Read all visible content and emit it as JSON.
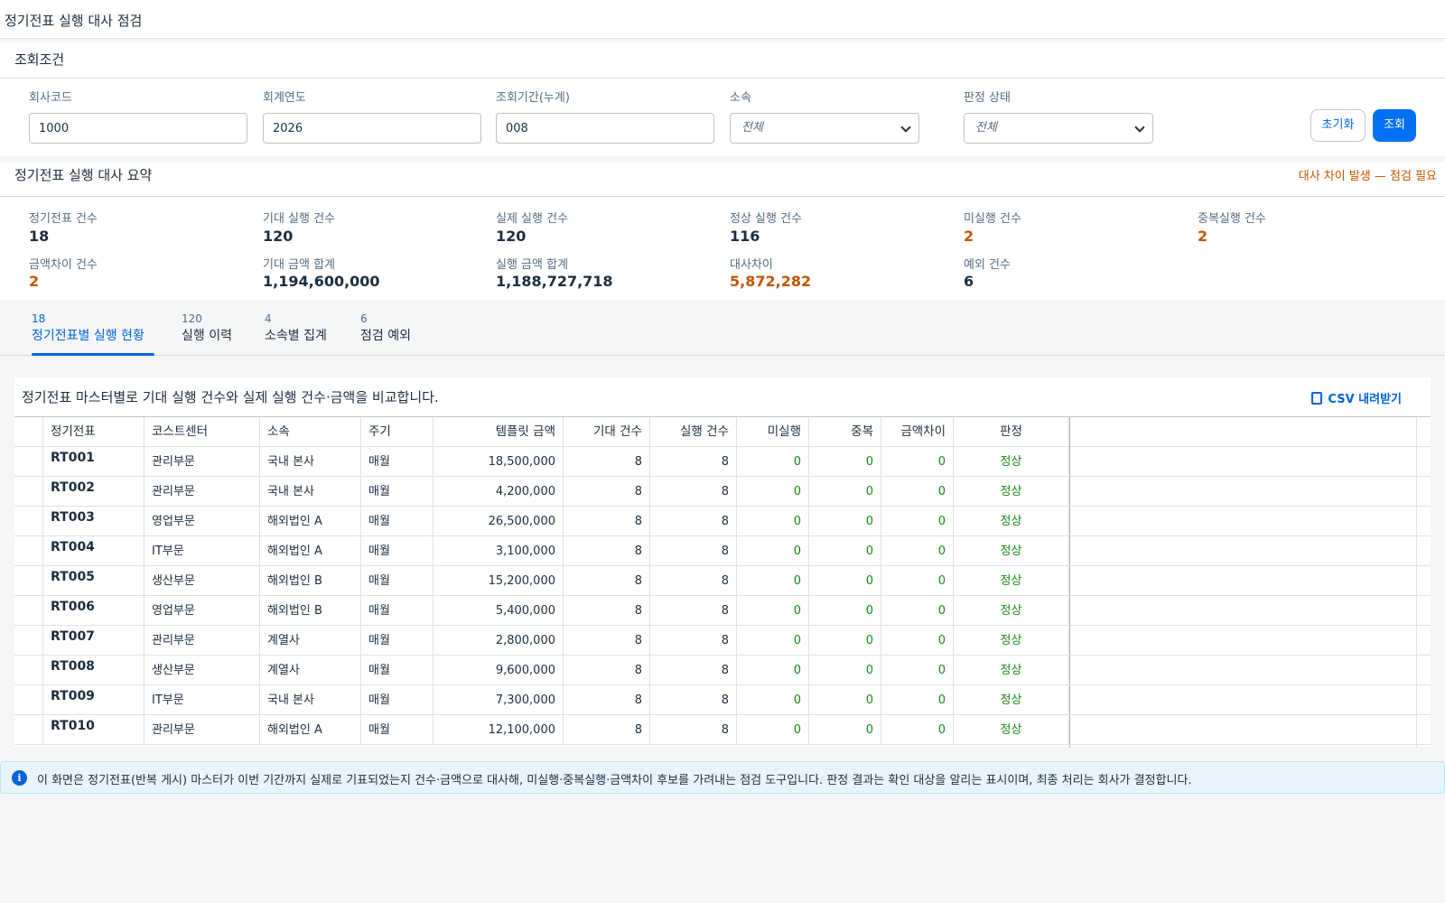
{
  "page": {
    "title": "정기전표 실행 대사 점검"
  },
  "filters": {
    "title": "조회조건",
    "company": {
      "label": "회사코드",
      "value": "1000"
    },
    "year": {
      "label": "회계연도",
      "value": "2026"
    },
    "period": {
      "label": "조회기간(누계)",
      "value": "008"
    },
    "affiliation": {
      "label": "소속",
      "value": "전체"
    },
    "status": {
      "label": "판정 상태",
      "value": "전체"
    },
    "reset_label": "초기화",
    "search_label": "조회"
  },
  "summary": {
    "title": "정기전표 실행 대사 요약",
    "alert": "대사 차이 발생 — 점검 필요",
    "stats": [
      {
        "label": "정기전표 건수",
        "value": "18"
      },
      {
        "label": "기대 실행 건수",
        "value": "120"
      },
      {
        "label": "실제 실행 건수",
        "value": "120"
      },
      {
        "label": "정상 실행 건수",
        "value": "116"
      },
      {
        "label": "미실행 건수",
        "value": "2"
      },
      {
        "label": "중복실행 건수",
        "value": "2"
      },
      {
        "label": "금액차이 건수",
        "value": "2"
      },
      {
        "label": "기대 금액 합계",
        "value": "1,194,600,000"
      },
      {
        "label": "실행 금액 합계",
        "value": "1,188,727,718"
      },
      {
        "label": "대사차이",
        "value": "5,872,282"
      },
      {
        "label": "예외 건수",
        "value": "6"
      }
    ]
  },
  "tabs": [
    {
      "count": "18",
      "label": "정기전표별 실행 현황"
    },
    {
      "count": "120",
      "label": "실행 이력"
    },
    {
      "count": "4",
      "label": "소속별 집계"
    },
    {
      "count": "6",
      "label": "점검 예외"
    }
  ],
  "table": {
    "description": "정기전표 마스터별로 기대 실행 건수와 실제 실행 건수·금액을 비교합니다.",
    "csv_label": "CSV 내려받기",
    "columns": [
      "정기전표",
      "코스트센터",
      "소속",
      "주기",
      "템플릿 금액",
      "기대 건수",
      "실행 건수",
      "미실행",
      "중복",
      "금액차이",
      "판정"
    ],
    "rows": [
      [
        "RT001",
        "관리부문",
        "국내 본사",
        "매월",
        "18,500,000",
        "8",
        "8",
        "0",
        "0",
        "0",
        "정상"
      ],
      [
        "RT002",
        "관리부문",
        "국내 본사",
        "매월",
        "4,200,000",
        "8",
        "8",
        "0",
        "0",
        "0",
        "정상"
      ],
      [
        "RT003",
        "영업부문",
        "해외법인 A",
        "매월",
        "26,500,000",
        "8",
        "8",
        "0",
        "0",
        "0",
        "정상"
      ],
      [
        "RT004",
        "IT부문",
        "해외법인 A",
        "매월",
        "3,100,000",
        "8",
        "8",
        "0",
        "0",
        "0",
        "정상"
      ],
      [
        "RT005",
        "생산부문",
        "해외법인 B",
        "매월",
        "15,200,000",
        "8",
        "8",
        "0",
        "0",
        "0",
        "정상"
      ],
      [
        "RT006",
        "영업부문",
        "해외법인 B",
        "매월",
        "5,400,000",
        "8",
        "8",
        "0",
        "0",
        "0",
        "정상"
      ],
      [
        "RT007",
        "관리부문",
        "계열사",
        "매월",
        "2,800,000",
        "8",
        "8",
        "0",
        "0",
        "0",
        "정상"
      ],
      [
        "RT008",
        "생산부문",
        "계열사",
        "매월",
        "9,600,000",
        "8",
        "8",
        "0",
        "0",
        "0",
        "정상"
      ],
      [
        "RT009",
        "IT부문",
        "국내 본사",
        "매월",
        "7,300,000",
        "8",
        "8",
        "0",
        "0",
        "0",
        "정상"
      ],
      [
        "RT010",
        "관리부문",
        "해외법인 A",
        "매월",
        "12,100,000",
        "8",
        "8",
        "0",
        "0",
        "0",
        "정상"
      ]
    ]
  },
  "info": {
    "icon": "info-icon",
    "text": "이 화면은 정기전표(반복 게시) 마스터가 이번 기간까지 실제로 기표되었는지 건수·금액으로 대사해, 미실행·중복실행·금액차이 후보를 가려내는 점검 도구입니다. 판정 결과는 확인 대상을 알리는 표시이며, 최종 처리는 회사가 결정합니다."
  },
  "colors": {
    "accent": "#0070f2",
    "warn": "#c35500",
    "ok": "#188918"
  }
}
